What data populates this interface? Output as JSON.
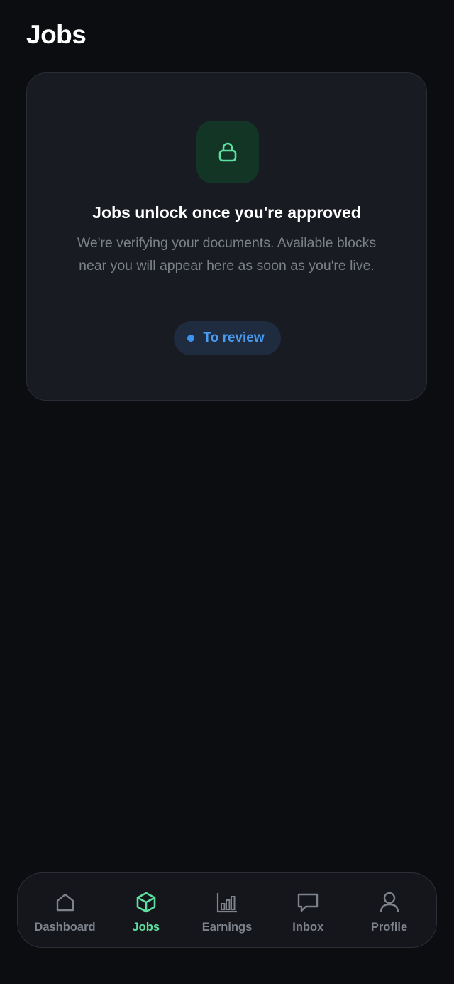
{
  "header": {
    "title": "Jobs"
  },
  "status_card": {
    "icon": "lock-icon",
    "heading": "Jobs unlock once you're approved",
    "body": "We're verifying your documents. Available blocks near you will appear here as soon as you're live.",
    "status_label": "To review",
    "status_color": "#3d94ee"
  },
  "nav": {
    "active": "Jobs",
    "items": [
      {
        "label": "Dashboard",
        "icon": "home-icon"
      },
      {
        "label": "Jobs",
        "icon": "box-icon"
      },
      {
        "label": "Earnings",
        "icon": "bar-chart-icon"
      },
      {
        "label": "Inbox",
        "icon": "chat-bubble-icon"
      },
      {
        "label": "Profile",
        "icon": "user-icon"
      }
    ]
  },
  "colors": {
    "background": "#0c0d10",
    "card": "#191b22",
    "accent": "#5fe0a0",
    "muted_text": "#7c8089"
  }
}
